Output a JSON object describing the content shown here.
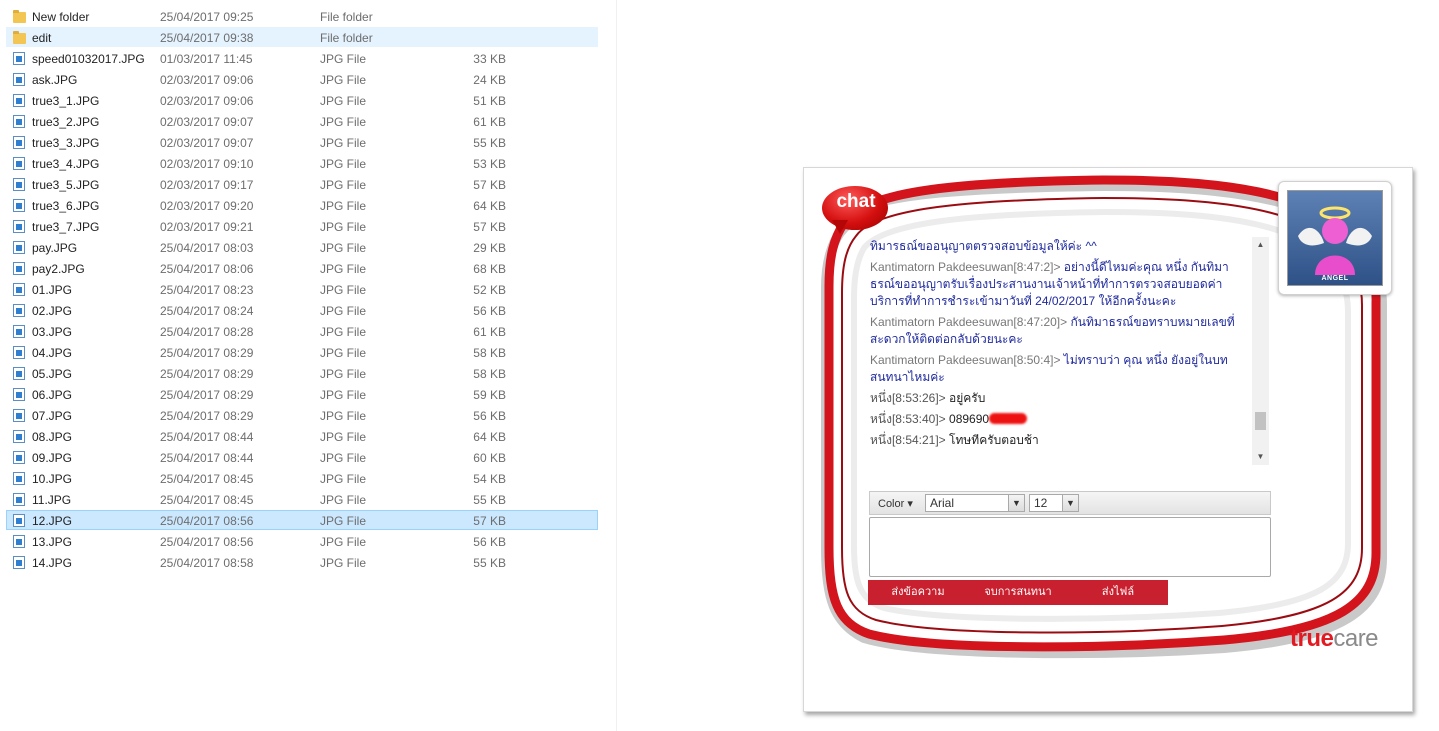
{
  "explorer": {
    "files": [
      {
        "name": "New folder",
        "date": "25/04/2017 09:25",
        "type": "File folder",
        "size": "",
        "icon": "folder-icon"
      },
      {
        "name": "edit",
        "date": "25/04/2017 09:38",
        "type": "File folder",
        "size": "",
        "icon": "folder-icon"
      },
      {
        "name": "speed01032017.JPG",
        "date": "01/03/2017 11:45",
        "type": "JPG File",
        "size": "33 KB",
        "icon": "jpg-file-icon"
      },
      {
        "name": "ask.JPG",
        "date": "02/03/2017 09:06",
        "type": "JPG File",
        "size": "24 KB",
        "icon": "jpg-file-icon"
      },
      {
        "name": "true3_1.JPG",
        "date": "02/03/2017 09:06",
        "type": "JPG File",
        "size": "51 KB",
        "icon": "jpg-file-icon"
      },
      {
        "name": "true3_2.JPG",
        "date": "02/03/2017 09:07",
        "type": "JPG File",
        "size": "61 KB",
        "icon": "jpg-file-icon"
      },
      {
        "name": "true3_3.JPG",
        "date": "02/03/2017 09:07",
        "type": "JPG File",
        "size": "55 KB",
        "icon": "jpg-file-icon"
      },
      {
        "name": "true3_4.JPG",
        "date": "02/03/2017 09:10",
        "type": "JPG File",
        "size": "53 KB",
        "icon": "jpg-file-icon"
      },
      {
        "name": "true3_5.JPG",
        "date": "02/03/2017 09:17",
        "type": "JPG File",
        "size": "57 KB",
        "icon": "jpg-file-icon"
      },
      {
        "name": "true3_6.JPG",
        "date": "02/03/2017 09:20",
        "type": "JPG File",
        "size": "64 KB",
        "icon": "jpg-file-icon"
      },
      {
        "name": "true3_7.JPG",
        "date": "02/03/2017 09:21",
        "type": "JPG File",
        "size": "57 KB",
        "icon": "jpg-file-icon"
      },
      {
        "name": "pay.JPG",
        "date": "25/04/2017 08:03",
        "type": "JPG File",
        "size": "29 KB",
        "icon": "jpg-file-icon"
      },
      {
        "name": "pay2.JPG",
        "date": "25/04/2017 08:06",
        "type": "JPG File",
        "size": "68 KB",
        "icon": "jpg-file-icon"
      },
      {
        "name": "01.JPG",
        "date": "25/04/2017 08:23",
        "type": "JPG File",
        "size": "52 KB",
        "icon": "jpg-file-icon"
      },
      {
        "name": "02.JPG",
        "date": "25/04/2017 08:24",
        "type": "JPG File",
        "size": "56 KB",
        "icon": "jpg-file-icon"
      },
      {
        "name": "03.JPG",
        "date": "25/04/2017 08:28",
        "type": "JPG File",
        "size": "61 KB",
        "icon": "jpg-file-icon"
      },
      {
        "name": "04.JPG",
        "date": "25/04/2017 08:29",
        "type": "JPG File",
        "size": "58 KB",
        "icon": "jpg-file-icon"
      },
      {
        "name": "05.JPG",
        "date": "25/04/2017 08:29",
        "type": "JPG File",
        "size": "58 KB",
        "icon": "jpg-file-icon"
      },
      {
        "name": "06.JPG",
        "date": "25/04/2017 08:29",
        "type": "JPG File",
        "size": "59 KB",
        "icon": "jpg-file-icon"
      },
      {
        "name": "07.JPG",
        "date": "25/04/2017 08:29",
        "type": "JPG File",
        "size": "56 KB",
        "icon": "jpg-file-icon"
      },
      {
        "name": "08.JPG",
        "date": "25/04/2017 08:44",
        "type": "JPG File",
        "size": "64 KB",
        "icon": "jpg-file-icon"
      },
      {
        "name": "09.JPG",
        "date": "25/04/2017 08:44",
        "type": "JPG File",
        "size": "60 KB",
        "icon": "jpg-file-icon"
      },
      {
        "name": "10.JPG",
        "date": "25/04/2017 08:45",
        "type": "JPG File",
        "size": "54 KB",
        "icon": "jpg-file-icon"
      },
      {
        "name": "11.JPG",
        "date": "25/04/2017 08:45",
        "type": "JPG File",
        "size": "55 KB",
        "icon": "jpg-file-icon"
      },
      {
        "name": "12.JPG",
        "date": "25/04/2017 08:56",
        "type": "JPG File",
        "size": "57 KB",
        "icon": "jpg-file-icon"
      },
      {
        "name": "13.JPG",
        "date": "25/04/2017 08:56",
        "type": "JPG File",
        "size": "56 KB",
        "icon": "jpg-file-icon"
      },
      {
        "name": "14.JPG",
        "date": "25/04/2017 08:58",
        "type": "JPG File",
        "size": "55 KB",
        "icon": "jpg-file-icon"
      }
    ],
    "selected_file": "12.JPG",
    "hovered_file": "edit",
    "selection_color": "#cce8ff"
  },
  "chat": {
    "logo_text": "chat",
    "avatar_label": "ANGEL",
    "messages": [
      {
        "who": "",
        "text": "ทิมารธณ์ขออนุญาตตรวจสอบข้อมูลให้ค่ะ ^^",
        "kind": "agent"
      },
      {
        "who": "Kantimatorn Pakdeesuwan[8:47:2]> ",
        "text": "อย่างนี้ดีไหมค่ะคุณ หนึ่ง กันทิมาธรณ์ขออนุญาตรับเรื่องประสานงานเจ้าหน้าที่ทำการตรวจสอบยอดค่าบริการที่ทำการชำระเข้ามาวันที่ 24/02/2017 ให้อีกครั้งนะคะ",
        "kind": "agent"
      },
      {
        "who": "Kantimatorn Pakdeesuwan[8:47:20]> ",
        "text": "กันทิมาธรณ์ขอทราบหมายเลขที่สะดวกให้ติดต่อกลับด้วยนะคะ",
        "kind": "agent"
      },
      {
        "who": "Kantimatorn Pakdeesuwan[8:50:4]> ",
        "text": "ไม่ทราบว่า คุณ หนึ่ง ยังอยู่ในบทสนทนาไหมค่ะ",
        "kind": "agent"
      },
      {
        "who": "หนึ่ง[8:53:26]> ",
        "text": "อยู่ครับ",
        "kind": "user"
      },
      {
        "who": "หนึ่ง[8:53:40]> ",
        "text": "089690",
        "kind": "user",
        "masked": true
      },
      {
        "who": "หนึ่ง[8:54:21]> ",
        "text": "โทษทีครับตอบช้า",
        "kind": "user"
      }
    ],
    "toolbar": {
      "color_label": "Color ▾",
      "font_value": "Arial",
      "size_value": "12"
    },
    "input_placeholder": "",
    "buttons": {
      "send_message": "ส่งข้อความ",
      "end_chat": "จบการสนทนา",
      "send_file": "ส่งไฟล์"
    },
    "brand": {
      "part1": "true",
      "part2": "care"
    },
    "colors": {
      "accent_red": "#c8202f",
      "brand_red": "#e21b23",
      "agent_text": "#1f2a9e"
    }
  }
}
